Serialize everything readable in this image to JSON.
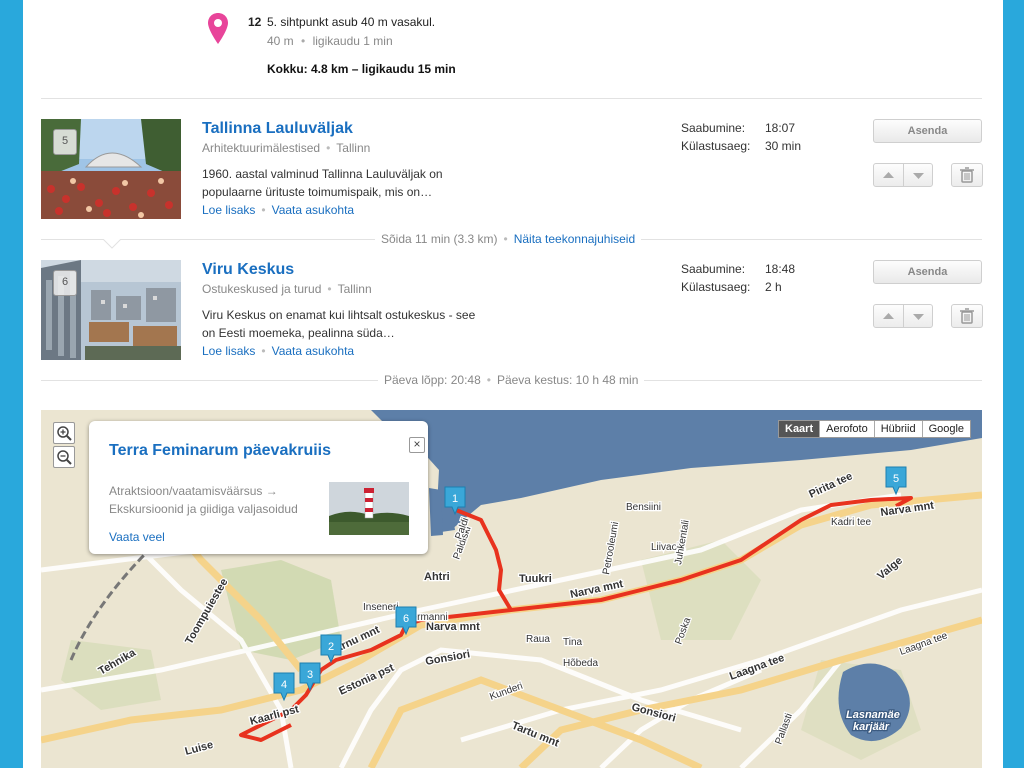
{
  "step": {
    "number": "12",
    "text": "5. sihtpunkt asub 40 m vasakul.",
    "distance": "40 m",
    "sep": "•",
    "duration": "ligikaudu 1 min",
    "total": "Kokku: 4.8 km – ligikaudu 15 min"
  },
  "places": [
    {
      "badge": "5",
      "title": "Tallinna Lauluväljak",
      "category": "Arhitektuurimälestised",
      "city": "Tallinn",
      "desc1": "1960. aastal valminud Tallinna Lauluväljak on",
      "desc2": "populaarne ürituste toimumispaik, mis on…",
      "read_more": "Loe lisaks",
      "see_location": "Vaata asukohta",
      "arrival_label": "Saabumine:",
      "arrival": "18:07",
      "visit_label": "Külastusaeg:",
      "visit": "30 min",
      "replace": "Asenda"
    },
    {
      "badge": "6",
      "title": "Viru Keskus",
      "category": "Ostukeskused ja turud",
      "city": "Tallinn",
      "desc1": "Viru Keskus on enamat kui lihtsalt ostukeskus - see",
      "desc2": "on Eesti moemeka, pealinna süda…",
      "read_more": "Loe lisaks",
      "see_location": "Vaata asukohta",
      "arrival_label": "Saabumine:",
      "arrival": "18:48",
      "visit_label": "Külastusaeg:",
      "visit": "2 h",
      "replace": "Asenda"
    }
  ],
  "drive": {
    "text": "Sõida 11 min (3.3 km)",
    "sep": "•",
    "link": "Näita teekonnajuhiseid"
  },
  "day": {
    "end": "Päeva lõpp: 20:48",
    "sep": "•",
    "duration": "Päeva kestus: 10 h 48 min"
  },
  "map": {
    "types": [
      "Kaart",
      "Aerofoto",
      "Hübriid",
      "Google"
    ],
    "active_type": "Kaart",
    "zoom_in": "+",
    "zoom_out": "−",
    "popup": {
      "title": "Terra Feminarum päevakruiis",
      "line1": "Atraktsioon/vaatamisväärsus →",
      "line2": "Ekskursioonid ja giidiga valjasoidud",
      "link": "Vaata veel",
      "close": "×"
    },
    "markers": [
      "1",
      "2",
      "3",
      "4",
      "5",
      "6"
    ],
    "lake_label": [
      "Lasnamäe",
      "karjäär"
    ],
    "street_labels": [
      "Narva mnt",
      "Narva mnt",
      "Narva mnt",
      "Tartu mnt",
      "Gonsiori",
      "Gonsiori",
      "Estonia pst",
      "Pärnu mnt",
      "Kaarli pst",
      "Laagna tee",
      "Laagna tee",
      "Pirita tee",
      "Valge",
      "Ahtri",
      "Tuukri",
      "Toompuiestee",
      "Tehnika",
      "Luise",
      "Liivaoja",
      "Raua",
      "Tina",
      "Hõbeda",
      "Kunderi",
      "Petrooleumi",
      "Bensiini",
      "Juhkentali",
      "Paldiski",
      "Kadri tee",
      "Rotermanni",
      "Insenerі",
      "Pallasti",
      "Paldi",
      "Poska"
    ],
    "colors": {
      "route": "#e8321e",
      "water": "#5d7fa8",
      "marker": "#3aa7d8",
      "pin": "#e8459a"
    }
  },
  "icons": [
    "map-pin-icon",
    "arrow-up-icon",
    "arrow-down-icon",
    "trash-icon",
    "zoom-in-icon",
    "zoom-out-icon",
    "close-icon",
    "route-marker-icon"
  ]
}
